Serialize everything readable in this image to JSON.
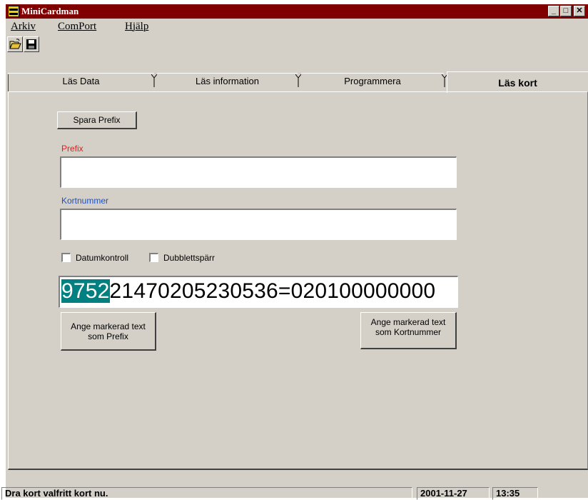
{
  "window": {
    "title": "MiniCardman",
    "controls": {
      "minimize": "_",
      "maximize": "□",
      "close": "✕"
    }
  },
  "menu": {
    "items": [
      "Arkiv",
      "ComPort",
      "Hjälp"
    ]
  },
  "toolbar": {
    "open_icon": "folder-open-icon",
    "save_icon": "floppy-disk-icon"
  },
  "tabs": [
    {
      "label": "Läs Data",
      "active": false
    },
    {
      "label": "Läs information",
      "active": false
    },
    {
      "label": "Programmera",
      "active": false
    },
    {
      "label": "Läs kort",
      "active": true
    }
  ],
  "form": {
    "save_prefix_button": "Spara Prefix",
    "prefix_label": "Prefix",
    "prefix_value": "",
    "card_number_label": "Kortnummer",
    "card_number_value": "",
    "date_check_label": "Datumkontroll",
    "date_check_checked": false,
    "duplicate_block_label": "Dubblettspärr",
    "duplicate_block_checked": false,
    "card_read_selected": "9752",
    "card_read_rest": "21470205230536=020100000000",
    "set_prefix_button_line1": "Ange markerad text",
    "set_prefix_button_line2": "som Prefix",
    "set_card_button_line1": "Ange markerad text",
    "set_card_button_line2": "som Kortnummer"
  },
  "colors": {
    "titlebar": "#800000",
    "prefix_label": "#e02020",
    "card_number_label": "#2050c0",
    "selection": "#008080"
  },
  "status": {
    "message": "Dra kort valfritt kort nu.",
    "date": "2001-11-27",
    "time": "13:35"
  }
}
